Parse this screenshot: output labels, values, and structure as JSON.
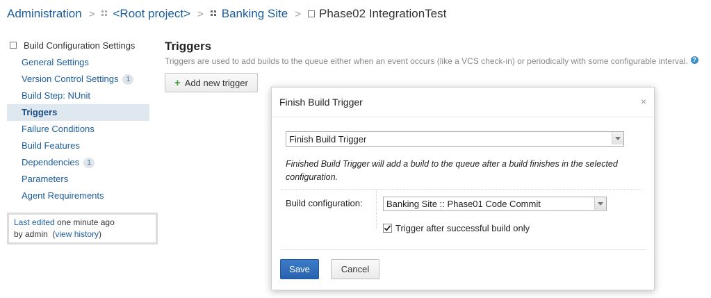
{
  "breadcrumb": {
    "items": [
      "Administration",
      "<Root project>",
      "Banking Site",
      "Phase02 IntegrationTest"
    ],
    "separator": ">"
  },
  "sidebar": {
    "title": "Build Configuration Settings",
    "items": [
      {
        "label": "General Settings",
        "badge": ""
      },
      {
        "label": "Version Control Settings",
        "badge": "1"
      },
      {
        "label": "Build Step: NUnit",
        "badge": ""
      },
      {
        "label": "Triggers",
        "badge": "",
        "active": true
      },
      {
        "label": "Failure Conditions",
        "badge": ""
      },
      {
        "label": "Build Features",
        "badge": ""
      },
      {
        "label": "Dependencies",
        "badge": "1"
      },
      {
        "label": "Parameters",
        "badge": ""
      },
      {
        "label": "Agent Requirements",
        "badge": ""
      }
    ],
    "edited": {
      "link1": "Last edited",
      "text1": " one minute ago",
      "text2": "by admin  (",
      "link2": "view history",
      "text3": ")"
    }
  },
  "main": {
    "title": "Triggers",
    "description": "Triggers are used to add builds to the queue either when an event occurs (like a VCS check-in) or periodically with some configurable interval.",
    "add_button": "Add new trigger"
  },
  "dialog": {
    "title": "Finish Build Trigger",
    "close": "×",
    "trigger_type": "Finish Build Trigger",
    "description": "Finished Build Trigger will add a build to the queue after a build finishes in the selected configuration.",
    "build_config_label": "Build configuration:",
    "build_config_value": "Banking Site :: Phase01 Code Commit",
    "checkbox_label": "Trigger after successful build only",
    "checkbox_checked": true,
    "save": "Save",
    "cancel": "Cancel"
  },
  "colors": {
    "link": "#1a5c9a",
    "active_bg": "#dfe7ef",
    "primary_button": "#2f6fbd"
  }
}
